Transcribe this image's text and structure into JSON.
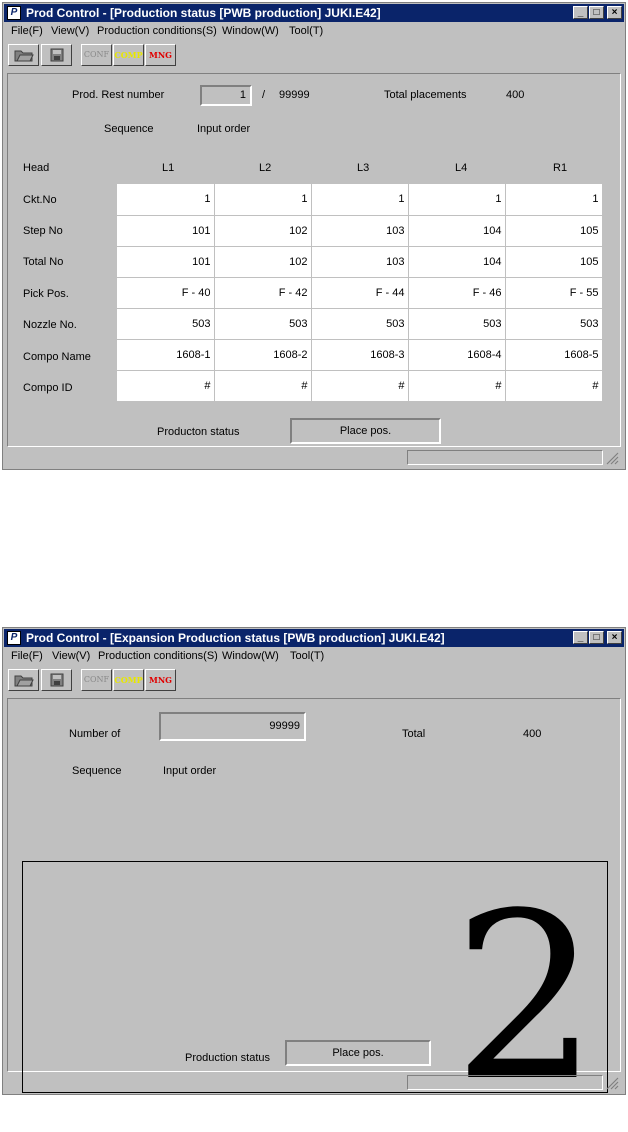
{
  "window1": {
    "title": "Prod Control - [Production status [PWB production] JUKI.E42]",
    "menu": [
      "File(F)",
      "View(V)",
      "Production conditions(S)",
      "Window(W)",
      "Tool(T)"
    ],
    "prod_rest_label": "Prod. Rest number",
    "prod_rest_value": "1",
    "slash": "/",
    "prod_total": "99999",
    "total_placements_label": "Total placements",
    "total_placements_value": "400",
    "sequence_label": "Sequence",
    "sequence_value": "Input order",
    "head_label": "Head",
    "heads": [
      "L1",
      "L2",
      "L3",
      "L4",
      "R1"
    ],
    "rows": [
      {
        "label": "Ckt.No",
        "values": [
          "1",
          "1",
          "1",
          "1",
          "1"
        ]
      },
      {
        "label": "Step No",
        "values": [
          "101",
          "102",
          "103",
          "104",
          "105"
        ]
      },
      {
        "label": "Total No",
        "values": [
          "101",
          "102",
          "103",
          "104",
          "105"
        ]
      },
      {
        "label": "Pick Pos.",
        "values": [
          "F - 40",
          "F - 42",
          "F - 44",
          "F - 46",
          "F - 55"
        ]
      },
      {
        "label": "Nozzle No.",
        "values": [
          "503",
          "503",
          "503",
          "503",
          "503"
        ]
      },
      {
        "label": "Compo Name",
        "values": [
          "1608-1",
          "1608-2",
          "1608-3",
          "1608-4",
          "1608-5"
        ]
      },
      {
        "label": "Compo ID",
        "values": [
          "#",
          "#",
          "#",
          "#",
          "#"
        ]
      }
    ],
    "status_label": "Producton status",
    "status_value": "Place pos."
  },
  "window2": {
    "title": "Prod Control - [Expansion Production status [PWB production] JUKI.E42]",
    "menu": [
      "File(F)",
      "View(V)",
      "Production conditions(S)",
      "Window(W)",
      "Tool(T)"
    ],
    "number_label": "Number of",
    "number_value": "99999",
    "total_label": "Total",
    "total_value": "400",
    "sequence_label": "Sequence",
    "sequence_value": "Input order",
    "big_number": "2",
    "status_label": "Production status",
    "status_value": "Place pos."
  },
  "toolbar": {
    "icons": [
      "open-folder-icon",
      "save-disk-icon",
      "conf-icon",
      "comp-icon",
      "mng-icon"
    ],
    "conf_label": "CONF",
    "comp_label": "COMP",
    "mng_label": "MNG"
  },
  "colors": {
    "titlebar": "#0a246a",
    "face": "#c0c0c0",
    "comp": "#e8e800",
    "mng": "#e00000"
  }
}
